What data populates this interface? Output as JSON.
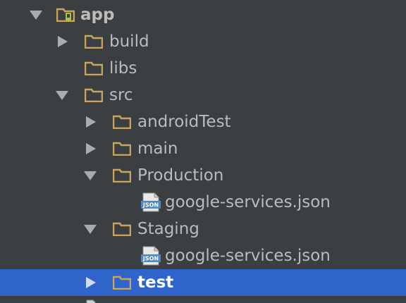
{
  "project_tree": {
    "app": "app",
    "build": "build",
    "libs": "libs",
    "src": "src",
    "android_test": "androidTest",
    "main": "main",
    "production": "Production",
    "production_google_services": "google-services.json",
    "staging": "Staging",
    "staging_google_services": "google-services.json",
    "test": "test",
    "json_badge": "JSON"
  },
  "colors": {
    "background": "#3c3f41",
    "selection": "#2f65ca",
    "folder": "#c9a55d",
    "text": "#bbbbbb",
    "selected_text": "#ffffff"
  },
  "icons": {
    "module": "android-module-folder-icon",
    "folder": "folder-icon",
    "json_file": "json-file-icon",
    "expanded": "expanded-arrow-icon",
    "collapsed": "collapsed-arrow-icon"
  },
  "selection": "test"
}
